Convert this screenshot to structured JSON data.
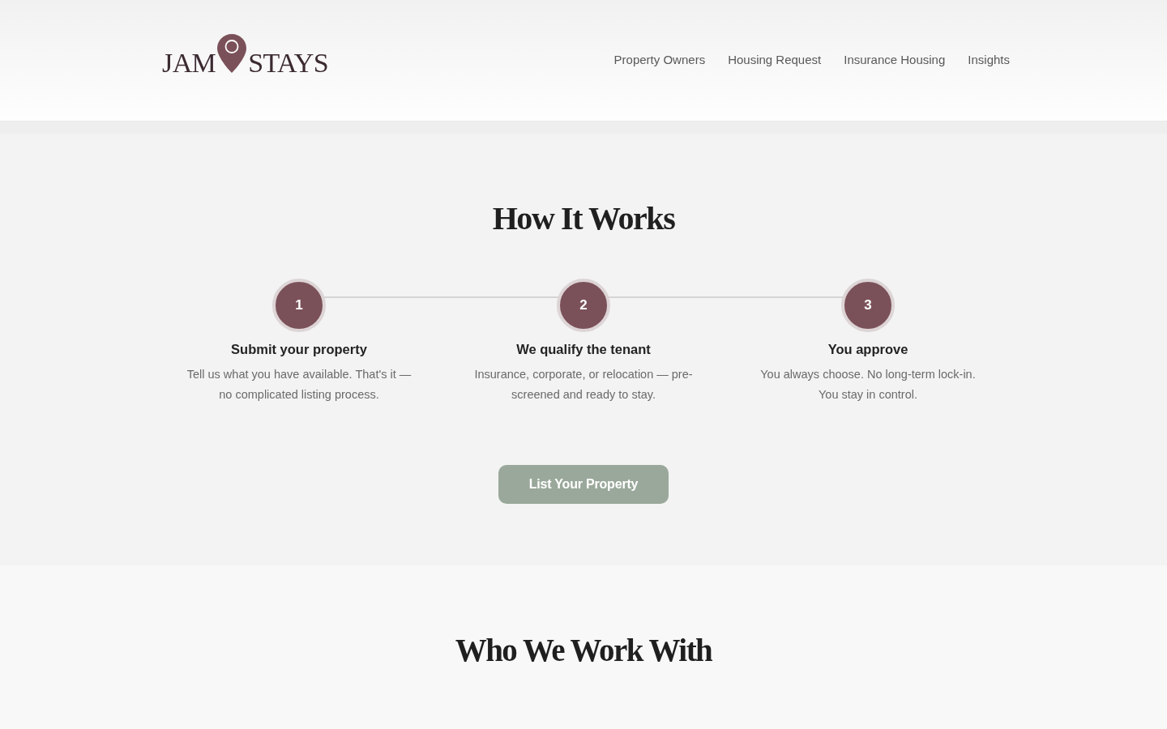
{
  "header": {
    "logo": {
      "text_left": "JAM",
      "text_right": "STAYS"
    },
    "nav": [
      {
        "label": "Property Owners"
      },
      {
        "label": "Housing Request"
      },
      {
        "label": "Insurance Housing"
      },
      {
        "label": "Insights"
      }
    ]
  },
  "how_it_works": {
    "title": "How It Works",
    "steps": [
      {
        "number": "1",
        "title": "Submit your property",
        "description": "Tell us what you have available. That's it — no complicated listing process."
      },
      {
        "number": "2",
        "title": "We qualify the tenant",
        "description": "Insurance, corporate, or relocation — pre-screened and ready to stay."
      },
      {
        "number": "3",
        "title": "You approve",
        "description": "You always choose. No long-term lock-in. You stay in control."
      }
    ],
    "cta_button": "List Your Property"
  },
  "who_we_work_with": {
    "title": "Who We Work With"
  }
}
